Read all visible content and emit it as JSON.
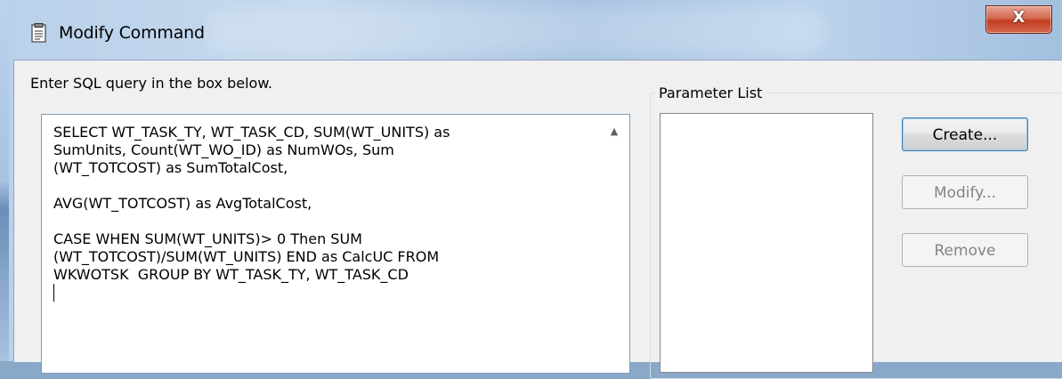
{
  "window": {
    "title": "Modify Command",
    "close_label": "X"
  },
  "prompt": "Enter SQL query in the box below.",
  "sql_query": "SELECT WT_TASK_TY, WT_TASK_CD, SUM(WT_UNITS) as\nSumUnits, Count(WT_WO_ID) as NumWOs, Sum\n(WT_TOTCOST) as SumTotalCost,\n\nAVG(WT_TOTCOST) as AvgTotalCost,\n\nCASE WHEN SUM(WT_UNITS)> 0 Then SUM\n(WT_TOTCOST)/SUM(WT_UNITS) END as CalcUC FROM\nWKWOTSK  GROUP BY WT_TASK_TY, WT_TASK_CD\n",
  "parameters": {
    "group_label": "Parameter List",
    "items": [],
    "buttons": {
      "create": "Create...",
      "modify": "Modify...",
      "remove": "Remove"
    }
  },
  "icons": {
    "title": "document-edit-icon",
    "scroll_up": "scroll-up-arrow-icon"
  }
}
